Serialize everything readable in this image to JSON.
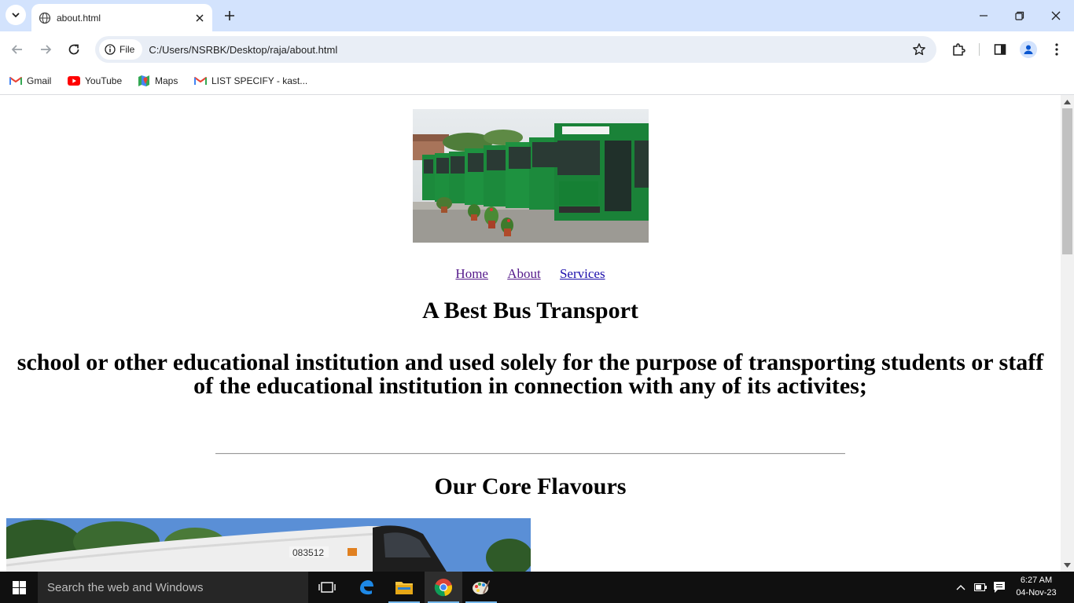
{
  "browser": {
    "tab_title": "about.html",
    "site_chip_label": "File",
    "url": "C:/Users/NSRBK/Desktop/raja/about.html",
    "bookmarks": [
      "Gmail",
      "YouTube",
      "Maps",
      "LIST SPECIFY - kast..."
    ]
  },
  "page": {
    "nav": [
      "Home",
      "About",
      "Services"
    ],
    "title": "A Best Bus Transport",
    "subtitle": "school or other educational institution and used solely for the purpose of transporting students or staff of the educational institution in connection with any of its activites;",
    "section_heading": "Our Core Flavours"
  },
  "taskbar": {
    "search_placeholder": "Search the web and Windows",
    "time": "6:27 AM",
    "date": "04-Nov-23"
  },
  "colors": {
    "tabbar": "#d3e3fd",
    "omnibox": "#e9eef6",
    "link": "#1a0dab",
    "visited_link": "#551a8b",
    "taskbar": "#101010",
    "bus_green": "#1c8a3c"
  }
}
